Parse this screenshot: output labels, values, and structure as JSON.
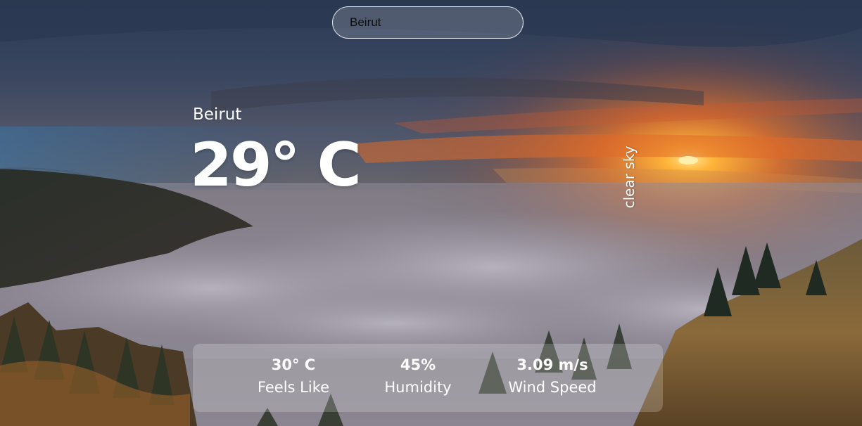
{
  "search": {
    "value": "Beirut"
  },
  "weather": {
    "city": "Beirut",
    "temperature": "29° C",
    "description": "clear sky"
  },
  "stats": {
    "feels_like": {
      "value": "30° C",
      "label": "Feels Like"
    },
    "humidity": {
      "value": "45%",
      "label": "Humidity"
    },
    "wind_speed": {
      "value": "3.09 m/s",
      "label": "Wind Speed"
    }
  },
  "background": {
    "description_icon": "landscape-photo",
    "colors": {
      "sky_top": "#2f3d55",
      "sunset": "#f0902a",
      "fog": "#9a9aa8",
      "forest": "#2a2e26"
    }
  }
}
